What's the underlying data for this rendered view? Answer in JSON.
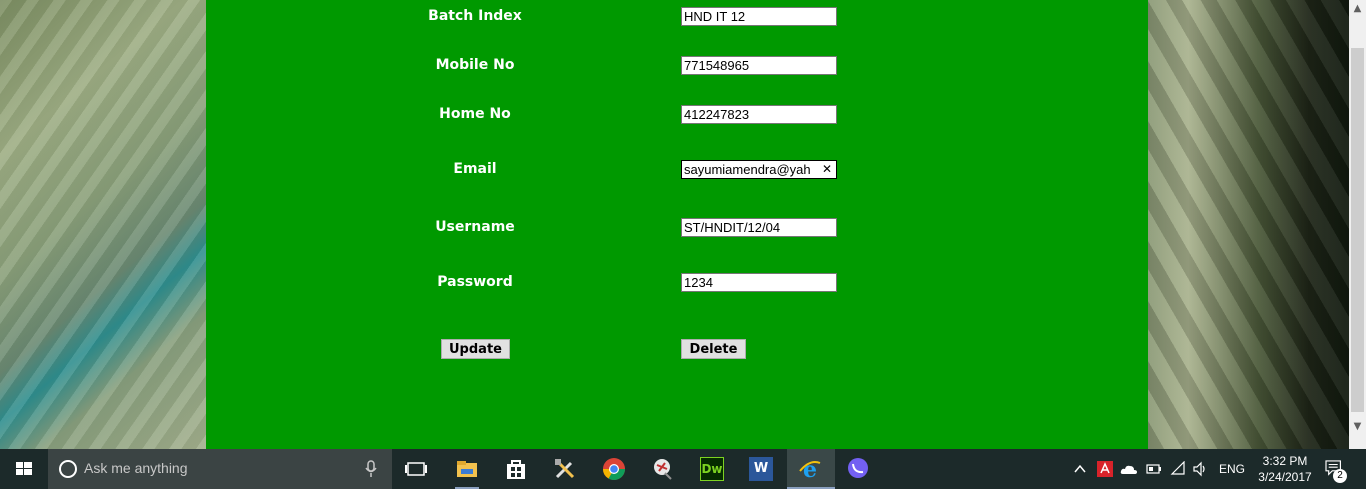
{
  "form": {
    "fields": [
      {
        "label": "Batch Index",
        "value": "HND IT 12"
      },
      {
        "label": "Mobile No",
        "value": "771548965"
      },
      {
        "label": "Home No",
        "value": "412247823"
      },
      {
        "label": "Email",
        "value": "sayumiamendra@yah"
      },
      {
        "label": "Username",
        "value": "ST/HNDIT/12/04"
      },
      {
        "label": "Password",
        "value": "1234"
      }
    ],
    "update_label": "Update",
    "delete_label": "Delete"
  },
  "taskbar": {
    "search_placeholder": "Ask me anything",
    "apps": [
      "task-view",
      "file-explorer",
      "store",
      "tools",
      "chrome",
      "app",
      "dreamweaver",
      "word",
      "internet-explorer",
      "viber"
    ],
    "dw_label": "Dw",
    "word_label": "W",
    "language": "ENG",
    "time": "3:32 PM",
    "date": "3/24/2017",
    "notification_count": "2"
  }
}
